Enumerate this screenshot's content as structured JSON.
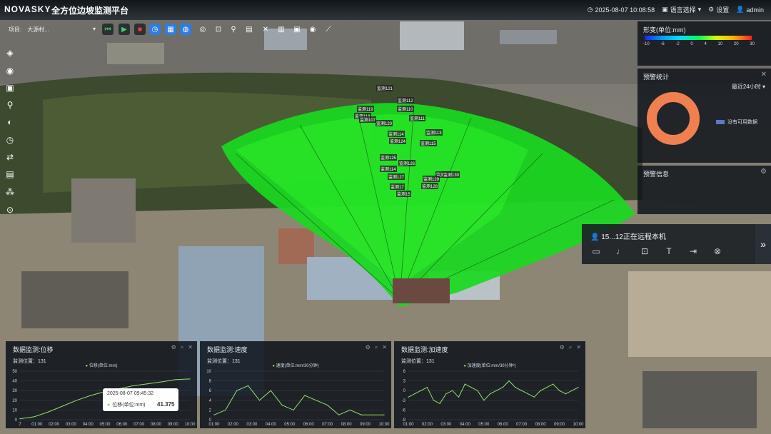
{
  "app": {
    "logo": "NOVASKY",
    "title": "全方位边坡监测平台",
    "datetime": "2025-08-07 10:08:58",
    "language": "语言选择",
    "settings": "设置",
    "user": "admin"
  },
  "project": {
    "label": "项目:",
    "value": "大源村..."
  },
  "toolbar_icons": [
    "back-icon",
    "play-icon",
    "stop-icon",
    "clock-icon",
    "image-icon",
    "grid-icon",
    "target-icon",
    "focus-icon",
    "pin-icon",
    "table-icon",
    "tools-icon",
    "building-icon",
    "layout-icon",
    "eye-icon",
    "measure-icon"
  ],
  "sidebar_icons": [
    "layers-icon",
    "wifi-icon",
    "image-icon",
    "map-pin-icon",
    "palette-icon",
    "alarm-icon",
    "shuffle-icon",
    "document-icon",
    "clusters-icon",
    "target-icon"
  ],
  "deform_panel": {
    "title": "形变(单位:mm)",
    "scale": [
      "-10",
      "-6",
      "-2",
      "0",
      "4",
      "10",
      "20",
      "30"
    ]
  },
  "warning_stats": {
    "title": "预警统计",
    "period": "最近24小时",
    "legend": "没有可用数据"
  },
  "warning_info": {
    "title": "预警信息"
  },
  "remote": {
    "label": "15...12正在远程本机"
  },
  "monitor_labels": [
    "监测121",
    "监测112",
    "监测119",
    "监测110",
    "监测118",
    "监测111",
    "监测120",
    "监测113",
    "监测114",
    "监测124",
    "监测115",
    "监测125",
    "监测126",
    "监测114",
    "监测16",
    "监测127",
    "监测17",
    "监测128",
    "监测15",
    "监测129",
    "监测130",
    "监测107"
  ],
  "panels": [
    {
      "title": "数据监测:位移",
      "point": "监测位置：131",
      "legend": "位移(单位:mm)"
    },
    {
      "title": "数据监测:速度",
      "point": "监测位置：131",
      "legend": "速度(单位:mm/30分钟)"
    },
    {
      "title": "数据监测:加速度",
      "point": "监测位置：131",
      "legend": "加速度(单位:mm/30分钟²)"
    }
  ],
  "tooltip": {
    "time": "2025-08-07 09:45:32",
    "label": "位移(单位:mm)",
    "value": "41.375"
  },
  "chart_data": [
    {
      "type": "line",
      "title": "数据监测:位移",
      "x": [
        "7",
        "01:00",
        "02:00",
        "03:00",
        "04:00",
        "05:00",
        "06:00",
        "07:00",
        "08:00",
        "09:00",
        "10:00"
      ],
      "y_ticks": [
        "0",
        "10",
        "20",
        "30",
        "40",
        "50"
      ],
      "ylim": [
        0,
        50
      ],
      "series": [
        {
          "name": "位移(单位:mm)",
          "values": [
            1,
            3,
            8,
            14,
            20,
            25,
            29,
            32,
            35,
            37,
            39,
            41.375,
            42
          ]
        }
      ]
    },
    {
      "type": "line",
      "title": "数据监测:速度",
      "x": [
        "01:00",
        "02:00",
        "03:00",
        "04:00",
        "05:00",
        "06:00",
        "07:00",
        "08:00",
        "09:00",
        "10:00"
      ],
      "y_ticks": [
        "0",
        "2",
        "4",
        "6",
        "8",
        "10"
      ],
      "ylim": [
        0,
        10
      ],
      "series": [
        {
          "name": "速度(单位:mm/30分钟)",
          "values": [
            1,
            2,
            6,
            7,
            4,
            6,
            3,
            2,
            5,
            4,
            3,
            1,
            2,
            1,
            1,
            1
          ]
        }
      ]
    },
    {
      "type": "line",
      "title": "数据监测:加速度",
      "x": [
        "01:00",
        "02:00",
        "03:00",
        "04:00",
        "05:00",
        "06:00",
        "07:00",
        "08:00",
        "09:00",
        "10:00"
      ],
      "y_ticks": [
        "-9",
        "-6",
        "-3",
        "0",
        "3",
        "6"
      ],
      "ylim": [
        -9,
        6
      ],
      "series": [
        {
          "name": "加速度(单位:mm/30分钟²)",
          "values": [
            -2,
            -1,
            0,
            1,
            -3,
            -4,
            -1,
            0,
            -2,
            2,
            1,
            0,
            -3,
            -1,
            0,
            1,
            3,
            1,
            0,
            -1,
            -2,
            0,
            1,
            2,
            0,
            -1,
            0,
            1
          ]
        }
      ]
    }
  ]
}
